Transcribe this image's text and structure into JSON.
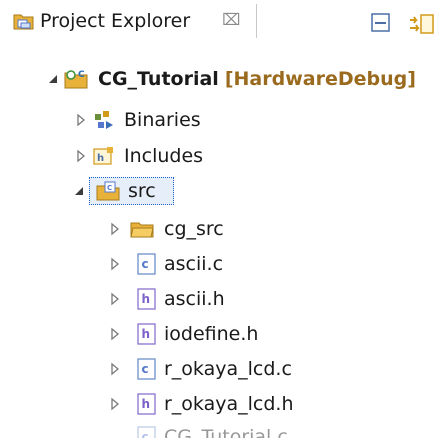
{
  "view": {
    "title": "Project Explorer",
    "close_glyph": "⌧",
    "toolbar": [
      {
        "name": "collapse-all-icon"
      },
      {
        "name": "link-with-editor-icon"
      }
    ]
  },
  "tree": {
    "project": {
      "label": "CG_Tutorial",
      "decoration": "[HardwareDebug]",
      "icon": "c-project-icon"
    },
    "binaries": {
      "label": "Binaries",
      "icon": "binaries-icon"
    },
    "includes": {
      "label": "Includes",
      "icon": "includes-icon"
    },
    "src": {
      "label": "src",
      "icon": "source-folder-icon"
    },
    "files": [
      {
        "label": "cg_src",
        "icon": "folder-icon"
      },
      {
        "label": "ascii.c",
        "icon": "c-file-icon"
      },
      {
        "label": "ascii.h",
        "icon": "h-file-icon"
      },
      {
        "label": "iodefine.h",
        "icon": "h-file-icon"
      },
      {
        "label": "r_okaya_lcd.c",
        "icon": "c-file-icon"
      },
      {
        "label": "r_okaya_lcd.h",
        "icon": "h-file-icon"
      },
      {
        "label": "CG_Tutorial.c",
        "icon": "c-file-icon"
      }
    ]
  },
  "colors": {
    "selection": "#e6eef9",
    "decoration": "#9a6b1f",
    "folder": "#e8b13a",
    "c_file": "#5577cc",
    "h_file": "#7b61c9"
  }
}
